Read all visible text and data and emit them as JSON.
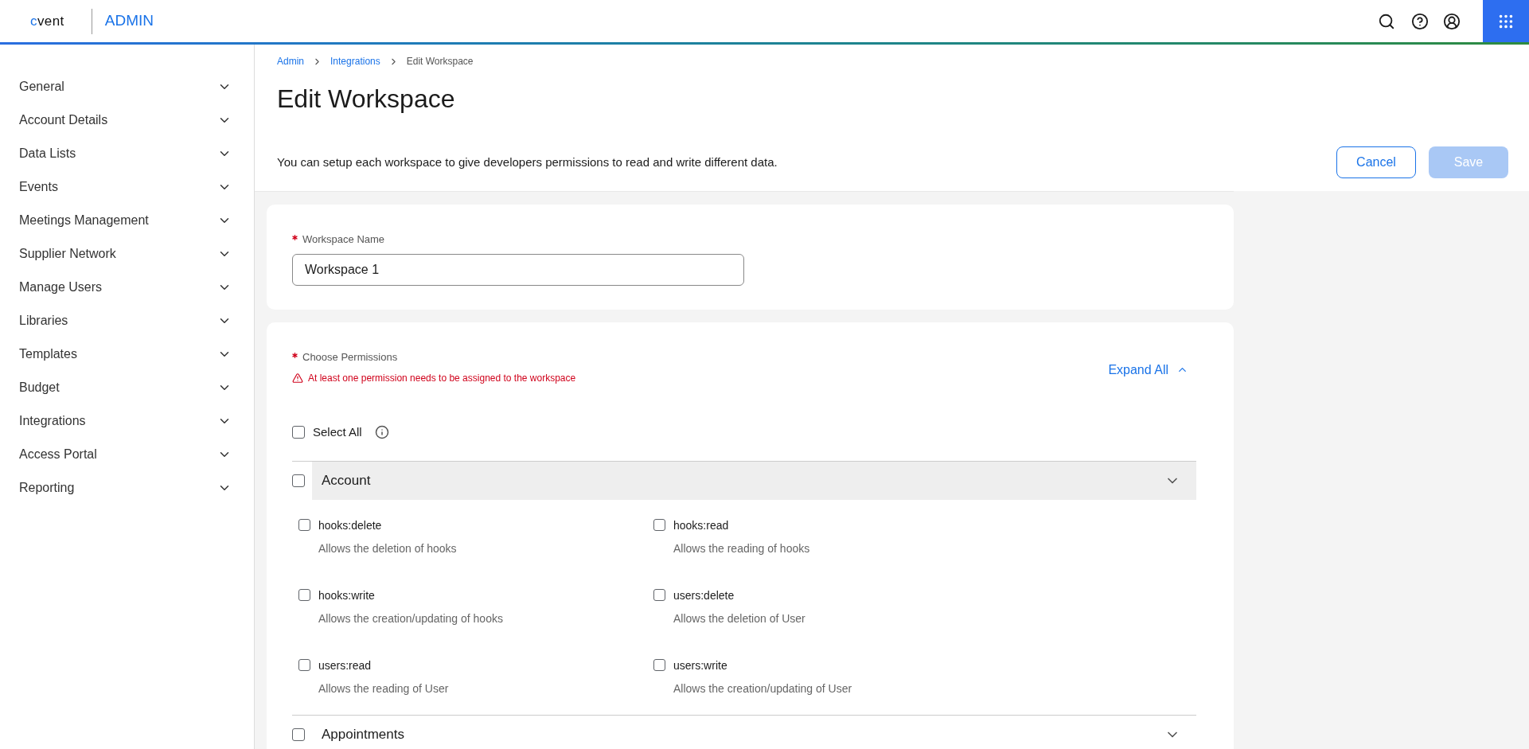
{
  "header": {
    "logo": "cvent",
    "app_name": "ADMIN"
  },
  "sidebar": {
    "items": [
      {
        "label": "General",
        "expanded": false
      },
      {
        "label": "Account Details",
        "expanded": false
      },
      {
        "label": "Data Lists",
        "expanded": false
      },
      {
        "label": "Events",
        "expanded": false
      },
      {
        "label": "Meetings Management",
        "expanded": false
      },
      {
        "label": "Supplier Network",
        "expanded": false
      },
      {
        "label": "Manage Users",
        "expanded": false
      },
      {
        "label": "Libraries",
        "expanded": false
      },
      {
        "label": "Templates",
        "expanded": false
      },
      {
        "label": "Budget",
        "expanded": false
      },
      {
        "label": "Integrations",
        "expanded": false
      },
      {
        "label": "Access Portal",
        "expanded": false
      },
      {
        "label": "Reporting",
        "expanded": false
      }
    ]
  },
  "breadcrumb": [
    {
      "label": "Admin",
      "link": true
    },
    {
      "label": "Integrations",
      "link": true
    },
    {
      "label": "Edit Workspace",
      "link": false
    }
  ],
  "title": "Edit Workspace",
  "description": "You can setup each workspace to give developers permissions to read and write different data.",
  "buttons": [
    {
      "label": "Cancel",
      "kind": "secondary",
      "disabled": false
    },
    {
      "label": "Save",
      "kind": "primary",
      "disabled": true
    }
  ],
  "workspace_name": {
    "label": "Workspace Name",
    "required": true,
    "value": "Workspace 1"
  },
  "permissions": {
    "label": "Choose Permissions",
    "required": true,
    "error": "At least one permission needs to be assigned to the workspace",
    "expand_all": "Expand All",
    "select_all": {
      "label": "Select All",
      "checked": false
    },
    "groups": [
      {
        "name": "Account",
        "checked": false,
        "expanded": true,
        "permissions": [
          {
            "name": "hooks:delete",
            "description": "Allows the deletion of hooks",
            "checked": false
          },
          {
            "name": "hooks:read",
            "description": "Allows the reading of hooks",
            "checked": false
          },
          {
            "name": "hooks:write",
            "description": "Allows the creation/updating of hooks",
            "checked": false
          },
          {
            "name": "users:delete",
            "description": "Allows the deletion of User",
            "checked": false
          },
          {
            "name": "users:read",
            "description": "Allows the reading of User",
            "checked": false
          },
          {
            "name": "users:write",
            "description": "Allows the creation/updating of User",
            "checked": false
          }
        ]
      },
      {
        "name": "Appointments",
        "checked": false,
        "expanded": false
      }
    ]
  }
}
